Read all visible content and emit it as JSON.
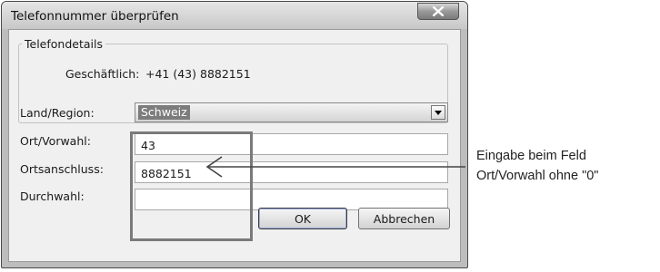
{
  "window": {
    "title": "Telefonnummer überprüfen",
    "close_icon": "close-x-icon"
  },
  "group": {
    "legend": "Telefondetails",
    "business_label": "Geschäftlich:",
    "business_value": "+41 (43) 8882151"
  },
  "form": {
    "region_label": "Land/Region:",
    "region_value": "Schweiz",
    "area_label": "Ort/Vorwahl:",
    "area_value": "43",
    "local_label": "Ortsanschluss:",
    "local_value": "8882151",
    "ext_label": "Durchwahl:",
    "ext_value": ""
  },
  "buttons": {
    "ok": "OK",
    "cancel": "Abbrechen"
  },
  "annotation": {
    "line1": "Eingabe beim Feld",
    "line2": "Ort/Vorwahl ohne \"0\""
  },
  "colors": {
    "highlight_box": "#7a7a7a",
    "selection": "#7c7c7c"
  }
}
